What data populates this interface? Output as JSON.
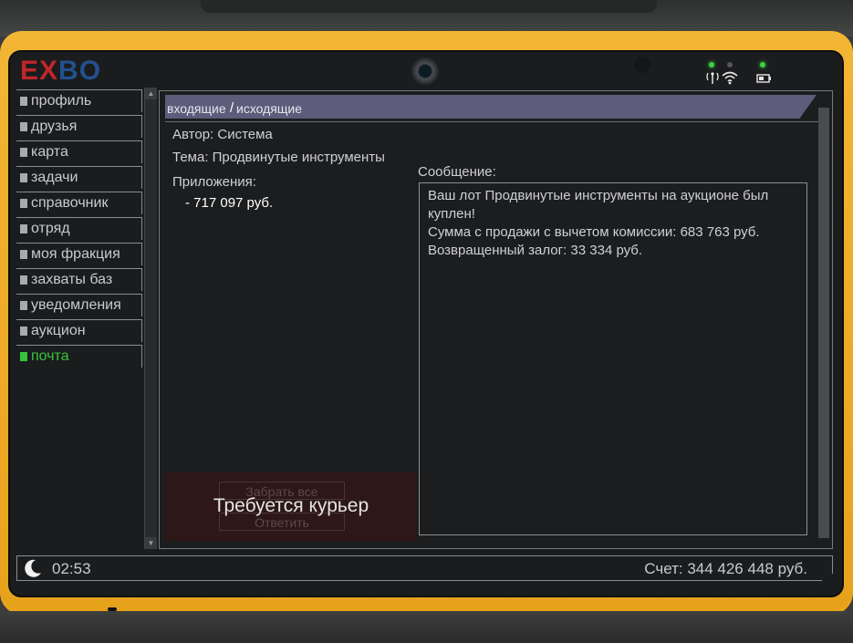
{
  "brand": {
    "logo_part1": "EX",
    "logo_part2": "BO"
  },
  "indicators": {
    "signal_icon": "antenna-icon",
    "wifi_icon": "wifi-icon",
    "battery_icon": "battery-icon",
    "led_color": "#38d23f"
  },
  "sidebar": {
    "items": [
      {
        "label": "профиль",
        "active": false
      },
      {
        "label": "друзья",
        "active": false
      },
      {
        "label": "карта",
        "active": false
      },
      {
        "label": "задачи",
        "active": false
      },
      {
        "label": "справочник",
        "active": false
      },
      {
        "label": "отряд",
        "active": false
      },
      {
        "label": "моя фракция",
        "active": false
      },
      {
        "label": "захваты баз",
        "active": false
      },
      {
        "label": "уведомления",
        "active": false
      },
      {
        "label": "аукцион",
        "active": false
      },
      {
        "label": "почта",
        "active": true
      }
    ]
  },
  "mail": {
    "tabs": {
      "inbox": "входящие",
      "separator": "/",
      "outbox": "исходящие"
    },
    "author": "Автор: Система",
    "subject": "Тема: Продвинутые инструменты",
    "attachments_label": "Приложения:",
    "attachment_value": "- 717 097 руб.",
    "message_label": "Сообщение:",
    "message_lines": [
      "Ваш лот Продвинутые инструменты на аукционе был",
      "куплен!",
      "Сумма с продажи с вычетом комиссии: 683 763 руб.",
      "Возвращенный залог: 33 334 руб."
    ],
    "take_all_label": "Забрать все",
    "reply_label": "Ответить",
    "courier_notice": "Требуется курьер"
  },
  "status": {
    "time": "02:53",
    "balance": "Счет: 344 426 448 руб."
  },
  "colors": {
    "active_nav": "#36c43a",
    "tab_bar": "#5d5c7a",
    "bezel": "#f0ae2c",
    "logo_red": "#c0262b",
    "logo_blue": "#23508f"
  }
}
